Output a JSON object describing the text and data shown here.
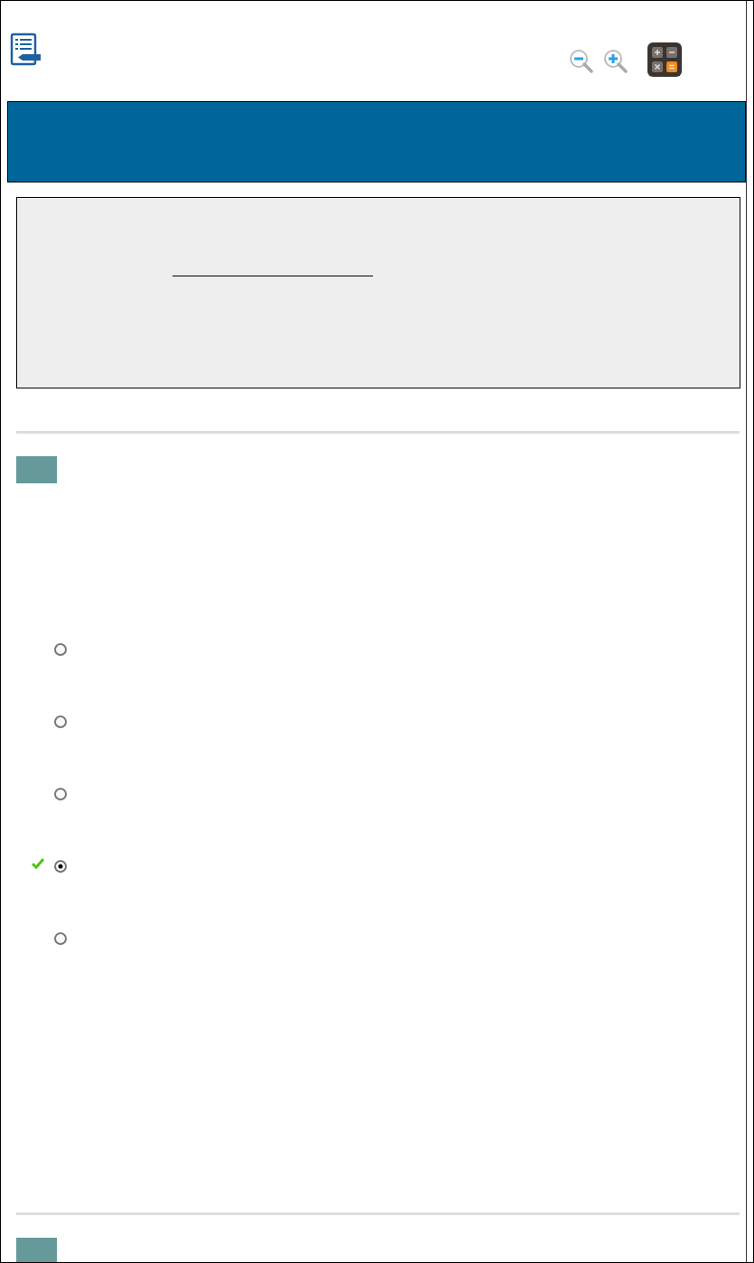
{
  "questions": [
    {
      "kind": "choice",
      "options": [
        {
          "selected": false,
          "correct": false
        },
        {
          "selected": false,
          "correct": false
        },
        {
          "selected": false,
          "correct": false
        },
        {
          "selected": true,
          "correct": true
        },
        {
          "selected": false,
          "correct": false
        }
      ]
    },
    {
      "kind": "collapsed"
    }
  ]
}
